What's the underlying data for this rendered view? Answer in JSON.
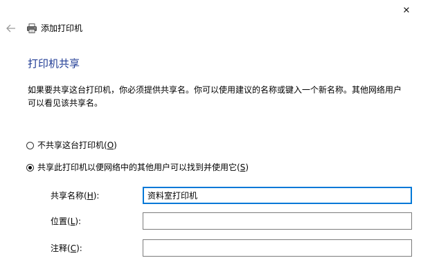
{
  "window": {
    "title": "添加打印机",
    "close_glyph": "✕",
    "back_glyph": "←"
  },
  "page": {
    "heading": "打印机共享",
    "description": "如果要共享这台打印机，你必须提供共享名。你可以使用建议的名称或键入一个新名称。其他网络用户可以看见该共享名。"
  },
  "sharing_options": {
    "selected": "share",
    "no_share": {
      "label": "不共享这台打印机(",
      "accel": "O",
      "suffix": ")"
    },
    "share": {
      "label": "共享此打印机以便网络中的其他用户可以找到并使用它(",
      "accel": "S",
      "suffix": ")"
    }
  },
  "fields": {
    "share_name": {
      "label_prefix": "共享名称(",
      "accel": "H",
      "label_suffix": "):",
      "value": "资料室打印机"
    },
    "location": {
      "label_prefix": "位置(",
      "accel": "L",
      "label_suffix": "):",
      "value": ""
    },
    "comment": {
      "label_prefix": "注释(",
      "accel": "C",
      "label_suffix": "):",
      "value": ""
    }
  },
  "colors": {
    "heading": "#1f3b94",
    "focus_border": "#0078d7",
    "input_border": "#7a7a7a"
  },
  "icons": {
    "back": "arrow-left-icon",
    "printer": "printer-icon",
    "close": "close-icon"
  }
}
